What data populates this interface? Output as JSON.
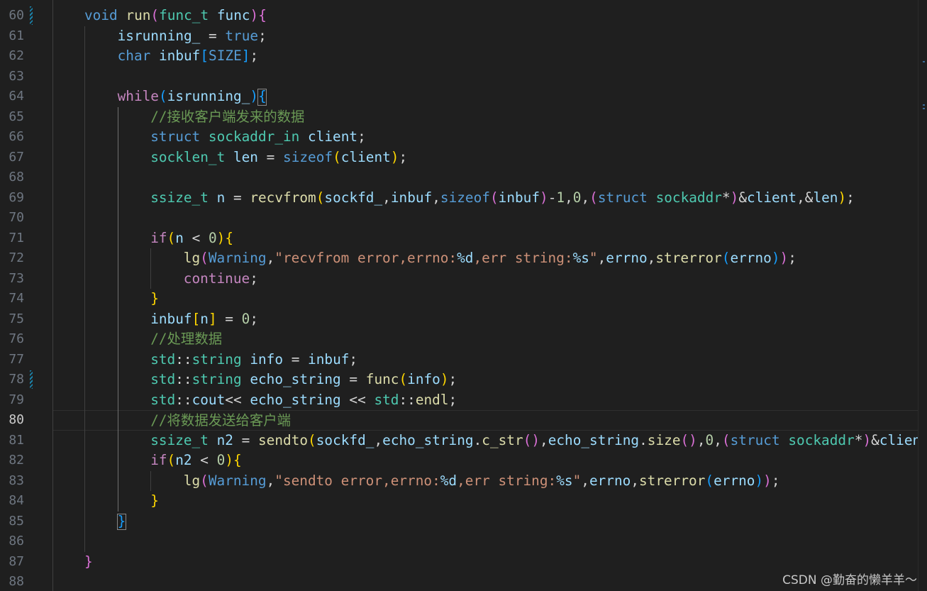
{
  "editor": {
    "current_line": 80,
    "watermark": "CSDN @勤奋的懒羊羊～",
    "lines": [
      {
        "num": 60,
        "indent": 1,
        "tokens": [
          [
            "kw",
            "void"
          ],
          [
            "op",
            " "
          ],
          [
            "fn",
            "run"
          ],
          [
            "b2",
            "("
          ],
          [
            "ty",
            "func_t"
          ],
          [
            "op",
            " "
          ],
          [
            "var",
            "func"
          ],
          [
            "b2",
            ")"
          ],
          [
            "b2",
            "{"
          ]
        ]
      },
      {
        "num": 61,
        "indent": 2,
        "tokens": [
          [
            "var",
            "isrunning_"
          ],
          [
            "op",
            " = "
          ],
          [
            "kw",
            "true"
          ],
          [
            "op",
            ";"
          ]
        ]
      },
      {
        "num": 62,
        "indent": 2,
        "tokens": [
          [
            "kw",
            "char"
          ],
          [
            "op",
            " "
          ],
          [
            "var",
            "inbuf"
          ],
          [
            "b3",
            "["
          ],
          [
            "mac",
            "SIZE"
          ],
          [
            "b3",
            "]"
          ],
          [
            "op",
            ";"
          ]
        ]
      },
      {
        "num": 63,
        "indent": 0,
        "tokens": []
      },
      {
        "num": 64,
        "indent": 2,
        "tokens": [
          [
            "ctl",
            "while"
          ],
          [
            "b3",
            "("
          ],
          [
            "var",
            "isrunning_"
          ],
          [
            "b3",
            ")"
          ],
          [
            "b3",
            "{"
          ]
        ]
      },
      {
        "num": 65,
        "indent": 3,
        "tokens": [
          [
            "cm",
            "//接收客户端发来的数据"
          ]
        ]
      },
      {
        "num": 66,
        "indent": 3,
        "tokens": [
          [
            "kw",
            "struct"
          ],
          [
            "op",
            " "
          ],
          [
            "ty",
            "sockaddr_in"
          ],
          [
            "op",
            " "
          ],
          [
            "var",
            "client"
          ],
          [
            "op",
            ";"
          ]
        ]
      },
      {
        "num": 67,
        "indent": 3,
        "tokens": [
          [
            "ty",
            "socklen_t"
          ],
          [
            "op",
            " "
          ],
          [
            "var",
            "len"
          ],
          [
            "op",
            " = "
          ],
          [
            "kw",
            "sizeof"
          ],
          [
            "b1",
            "("
          ],
          [
            "var",
            "client"
          ],
          [
            "b1",
            ")"
          ],
          [
            "op",
            ";"
          ]
        ]
      },
      {
        "num": 68,
        "indent": 0,
        "tokens": []
      },
      {
        "num": 69,
        "indent": 3,
        "tokens": [
          [
            "ty",
            "ssize_t"
          ],
          [
            "op",
            " "
          ],
          [
            "var",
            "n"
          ],
          [
            "op",
            " = "
          ],
          [
            "fn",
            "recvfrom"
          ],
          [
            "b1",
            "("
          ],
          [
            "var",
            "sockfd_"
          ],
          [
            "op",
            ","
          ],
          [
            "var",
            "inbuf"
          ],
          [
            "op",
            ","
          ],
          [
            "kw",
            "sizeof"
          ],
          [
            "b2",
            "("
          ],
          [
            "var",
            "inbuf"
          ],
          [
            "b2",
            ")"
          ],
          [
            "op",
            "-"
          ],
          [
            "num",
            "1"
          ],
          [
            "op",
            ","
          ],
          [
            "num",
            "0"
          ],
          [
            "op",
            ","
          ],
          [
            "b2",
            "("
          ],
          [
            "kw",
            "struct"
          ],
          [
            "op",
            " "
          ],
          [
            "ty",
            "sockaddr"
          ],
          [
            "op",
            "*"
          ],
          [
            "b2",
            ")"
          ],
          [
            "op",
            "&"
          ],
          [
            "var",
            "client"
          ],
          [
            "op",
            ",&"
          ],
          [
            "var",
            "len"
          ],
          [
            "b1",
            ")"
          ],
          [
            "op",
            ";"
          ]
        ]
      },
      {
        "num": 70,
        "indent": 0,
        "tokens": []
      },
      {
        "num": 71,
        "indent": 3,
        "tokens": [
          [
            "ctl",
            "if"
          ],
          [
            "b1",
            "("
          ],
          [
            "var",
            "n"
          ],
          [
            "op",
            " < "
          ],
          [
            "num",
            "0"
          ],
          [
            "b1",
            ")"
          ],
          [
            "b1",
            "{"
          ]
        ]
      },
      {
        "num": 72,
        "indent": 4,
        "tokens": [
          [
            "fn",
            "lg"
          ],
          [
            "b2",
            "("
          ],
          [
            "mac",
            "Warning"
          ],
          [
            "op",
            ","
          ],
          [
            "str",
            "\"recvfrom error,errno:"
          ],
          [
            "fmt",
            "%d"
          ],
          [
            "str",
            ",err string:"
          ],
          [
            "fmt",
            "%s"
          ],
          [
            "str",
            "\""
          ],
          [
            "op",
            ","
          ],
          [
            "var",
            "errno"
          ],
          [
            "op",
            ","
          ],
          [
            "fn",
            "strerror"
          ],
          [
            "b3",
            "("
          ],
          [
            "var",
            "errno"
          ],
          [
            "b3",
            ")"
          ],
          [
            "b2",
            ")"
          ],
          [
            "op",
            ";"
          ]
        ]
      },
      {
        "num": 73,
        "indent": 4,
        "tokens": [
          [
            "ctl",
            "continue"
          ],
          [
            "op",
            ";"
          ]
        ]
      },
      {
        "num": 74,
        "indent": 3,
        "tokens": [
          [
            "b1",
            "}"
          ]
        ]
      },
      {
        "num": 75,
        "indent": 3,
        "tokens": [
          [
            "var",
            "inbuf"
          ],
          [
            "b1",
            "["
          ],
          [
            "var",
            "n"
          ],
          [
            "b1",
            "]"
          ],
          [
            "op",
            " = "
          ],
          [
            "num",
            "0"
          ],
          [
            "op",
            ";"
          ]
        ]
      },
      {
        "num": 76,
        "indent": 3,
        "tokens": [
          [
            "cm",
            "//处理数据"
          ]
        ]
      },
      {
        "num": 77,
        "indent": 3,
        "tokens": [
          [
            "ns",
            "std"
          ],
          [
            "op",
            "::"
          ],
          [
            "ty",
            "string"
          ],
          [
            "op",
            " "
          ],
          [
            "var",
            "info"
          ],
          [
            "op",
            " = "
          ],
          [
            "var",
            "inbuf"
          ],
          [
            "op",
            ";"
          ]
        ]
      },
      {
        "num": 78,
        "indent": 3,
        "tokens": [
          [
            "ns",
            "std"
          ],
          [
            "op",
            "::"
          ],
          [
            "ty",
            "string"
          ],
          [
            "op",
            " "
          ],
          [
            "var",
            "echo_string"
          ],
          [
            "op",
            " = "
          ],
          [
            "fn",
            "func"
          ],
          [
            "b1",
            "("
          ],
          [
            "var",
            "info"
          ],
          [
            "b1",
            ")"
          ],
          [
            "op",
            ";"
          ]
        ]
      },
      {
        "num": 79,
        "indent": 3,
        "tokens": [
          [
            "ns",
            "std"
          ],
          [
            "op",
            "::"
          ],
          [
            "var",
            "cout"
          ],
          [
            "op",
            "<< "
          ],
          [
            "var",
            "echo_string"
          ],
          [
            "op",
            " << "
          ],
          [
            "ns",
            "std"
          ],
          [
            "op",
            "::"
          ],
          [
            "fn",
            "endl"
          ],
          [
            "op",
            ";"
          ]
        ]
      },
      {
        "num": 80,
        "indent": 3,
        "tokens": [
          [
            "cm",
            "//将数据发送给客户端"
          ]
        ]
      },
      {
        "num": 81,
        "indent": 3,
        "tokens": [
          [
            "ty",
            "ssize_t"
          ],
          [
            "op",
            " "
          ],
          [
            "var",
            "n2"
          ],
          [
            "op",
            " = "
          ],
          [
            "fn",
            "sendto"
          ],
          [
            "b1",
            "("
          ],
          [
            "var",
            "sockfd_"
          ],
          [
            "op",
            ","
          ],
          [
            "var",
            "echo_string"
          ],
          [
            "op",
            "."
          ],
          [
            "fn",
            "c_str"
          ],
          [
            "b2",
            "()"
          ],
          [
            "op",
            ","
          ],
          [
            "var",
            "echo_string"
          ],
          [
            "op",
            "."
          ],
          [
            "fn",
            "size"
          ],
          [
            "b2",
            "()"
          ],
          [
            "op",
            ","
          ],
          [
            "num",
            "0"
          ],
          [
            "op",
            ","
          ],
          [
            "b2",
            "("
          ],
          [
            "kw",
            "struct"
          ],
          [
            "op",
            " "
          ],
          [
            "ty",
            "sockaddr"
          ],
          [
            "op",
            "*"
          ],
          [
            "b2",
            ")"
          ],
          [
            "op",
            "&"
          ],
          [
            "var",
            "client"
          ]
        ]
      },
      {
        "num": 82,
        "indent": 3,
        "tokens": [
          [
            "ctl",
            "if"
          ],
          [
            "b1",
            "("
          ],
          [
            "var",
            "n2"
          ],
          [
            "op",
            " < "
          ],
          [
            "num",
            "0"
          ],
          [
            "b1",
            ")"
          ],
          [
            "b1",
            "{"
          ]
        ]
      },
      {
        "num": 83,
        "indent": 4,
        "tokens": [
          [
            "fn",
            "lg"
          ],
          [
            "b2",
            "("
          ],
          [
            "mac",
            "Warning"
          ],
          [
            "op",
            ","
          ],
          [
            "str",
            "\"sendto error,errno:"
          ],
          [
            "fmt",
            "%d"
          ],
          [
            "str",
            ",err string:"
          ],
          [
            "fmt",
            "%s"
          ],
          [
            "str",
            "\""
          ],
          [
            "op",
            ","
          ],
          [
            "var",
            "errno"
          ],
          [
            "op",
            ","
          ],
          [
            "fn",
            "strerror"
          ],
          [
            "b3",
            "("
          ],
          [
            "var",
            "errno"
          ],
          [
            "b3",
            ")"
          ],
          [
            "b2",
            ")"
          ],
          [
            "op",
            ";"
          ]
        ]
      },
      {
        "num": 84,
        "indent": 3,
        "tokens": [
          [
            "b1",
            "}"
          ]
        ]
      },
      {
        "num": 85,
        "indent": 2,
        "tokens": [
          [
            "b3",
            "}"
          ]
        ]
      },
      {
        "num": 86,
        "indent": 0,
        "tokens": []
      },
      {
        "num": 87,
        "indent": 1,
        "tokens": [
          [
            "b2",
            "}"
          ]
        ]
      },
      {
        "num": 88,
        "indent": 0,
        "tokens": []
      }
    ]
  },
  "colors": {
    "background": "#1f1f1f",
    "line_number": "#6e7681",
    "line_number_active": "#cccccc",
    "comment": "#6a9955",
    "keyword": "#569cd6",
    "control": "#c586c0",
    "function": "#dcdcaa",
    "variable": "#9cdcfe",
    "type": "#4ec9b0",
    "string": "#ce9178",
    "bracket_level1": "#ffd700",
    "bracket_level2": "#da70d6",
    "bracket_level3": "#179fff"
  },
  "modified_lines": [
    60,
    78
  ]
}
